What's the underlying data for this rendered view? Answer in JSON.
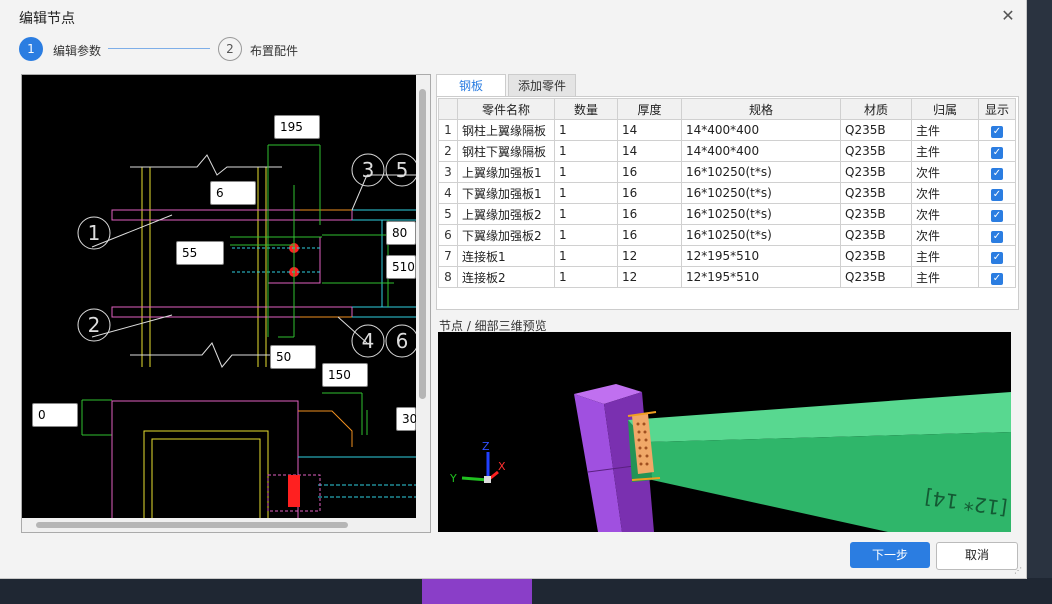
{
  "dialog": {
    "title": "编辑节点"
  },
  "steps": [
    {
      "number": "1",
      "label": "编辑参数"
    },
    {
      "number": "2",
      "label": "布置配件"
    }
  ],
  "cad": {
    "dims": [
      "195",
      "6",
      "55",
      "80",
      "510",
      "50",
      "150",
      "0",
      "30"
    ],
    "callouts": [
      "1",
      "2",
      "3",
      "5",
      "4",
      "6"
    ]
  },
  "tabs": [
    "钢板",
    "添加零件"
  ],
  "table": {
    "headers": [
      "零件名称",
      "数量",
      "厚度",
      "规格",
      "材质",
      "归属",
      "显示"
    ],
    "rows": [
      {
        "idx": "1",
        "name": "钢柱上翼缘隔板",
        "qty": "1",
        "thk": "14",
        "spec": "14*400*400",
        "mat": "Q235B",
        "owner": "主件",
        "show": true
      },
      {
        "idx": "2",
        "name": "钢柱下翼缘隔板",
        "qty": "1",
        "thk": "14",
        "spec": "14*400*400",
        "mat": "Q235B",
        "owner": "主件",
        "show": true
      },
      {
        "idx": "3",
        "name": "上翼缘加强板1",
        "qty": "1",
        "thk": "16",
        "spec": "16*10250(t*s)",
        "mat": "Q235B",
        "owner": "次件",
        "show": true
      },
      {
        "idx": "4",
        "name": "下翼缘加强板1",
        "qty": "1",
        "thk": "16",
        "spec": "16*10250(t*s)",
        "mat": "Q235B",
        "owner": "次件",
        "show": true
      },
      {
        "idx": "5",
        "name": "上翼缘加强板2",
        "qty": "1",
        "thk": "16",
        "spec": "16*10250(t*s)",
        "mat": "Q235B",
        "owner": "次件",
        "show": true
      },
      {
        "idx": "6",
        "name": "下翼缘加强板2",
        "qty": "1",
        "thk": "16",
        "spec": "16*10250(t*s)",
        "mat": "Q235B",
        "owner": "次件",
        "show": true
      },
      {
        "idx": "7",
        "name": "连接板1",
        "qty": "1",
        "thk": "12",
        "spec": "12*195*510",
        "mat": "Q235B",
        "owner": "主件",
        "show": true
      },
      {
        "idx": "8",
        "name": "连接板2",
        "qty": "1",
        "thk": "12",
        "spec": "12*195*510",
        "mat": "Q235B",
        "owner": "主件",
        "show": true
      }
    ]
  },
  "preview": {
    "label": "节点 / 细部三维预览",
    "beam_text": "[12* 14]",
    "axes": [
      "X",
      "Y",
      "Z"
    ]
  },
  "buttons": {
    "next": "下一步",
    "cancel": "取消"
  },
  "colors": {
    "accent": "#2b7de1",
    "beam": "#2fb66a",
    "column": "#a050e0"
  }
}
